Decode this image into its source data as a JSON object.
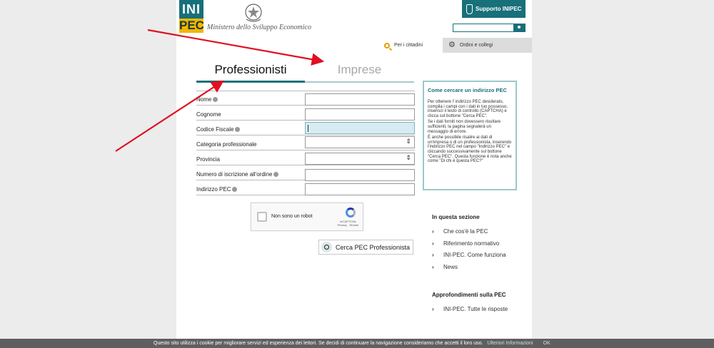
{
  "header": {
    "logo_top": "INI",
    "logo_bottom": "PEC",
    "ministry": "Ministero dello Sviluppo Economico",
    "support_label": "Supporto INIPEC",
    "search_placeholder": ""
  },
  "nav": {
    "cittadini": "Per i cittadini",
    "ordini": "Ordini e collegi"
  },
  "tabs": [
    {
      "label": "Professionisti",
      "active": true
    },
    {
      "label": "Imprese",
      "active": false
    }
  ],
  "form": {
    "fields": [
      {
        "label": "Nome",
        "info": true,
        "type": "text",
        "value": ""
      },
      {
        "label": "Cognome",
        "info": false,
        "type": "text",
        "value": ""
      },
      {
        "label": "Codice Fiscale",
        "info": true,
        "type": "text",
        "value": ""
      },
      {
        "label": "Categoria professionale",
        "info": false,
        "type": "select",
        "value": ""
      },
      {
        "label": "Provincia",
        "info": false,
        "type": "select",
        "value": ""
      },
      {
        "label": "Numero di iscrizione all'ordine",
        "info": true,
        "type": "text",
        "value": ""
      },
      {
        "label": "Indirizzo PEC",
        "info": true,
        "type": "text",
        "value": ""
      }
    ],
    "captcha_text": "Non sono un robot",
    "captcha_brand": "reCAPTCHA",
    "captcha_links": "Privacy - Termini",
    "submit_label": "Cerca PEC Professionista"
  },
  "help": {
    "title": "Come cercare un indirizzo PEC",
    "paragraphs": [
      "Per ottenere l' indirizzo PEC desiderato, compila i campi con i dati in tuo possesso, inserisci il testo di controllo (CAPTCHA) e clicca sul bottone \"Cerca PEC\".",
      "Se i dati forniti non dovessero risultare sufficienti, la pagina segnalerà un messaggio di errore.",
      "È anche possibile risalire ai dati di un'impresa o di un professionista, inserendo l'indirizzo PEC nel campo \"Indirizzo PEC\" e cliccando successivamente sul bottone \"Cerca PEC\". Questa funzione è nota anche come \"Di chi è questa PEC?\""
    ]
  },
  "section": {
    "heading": "In questa sezione",
    "items": [
      "Che cos'è la PEC",
      "Riferimento normativo",
      "INI-PEC. Come funziona",
      "News"
    ],
    "heading2": "Approfondimenti sulla PEC",
    "items2": [
      "INI-PEC. Tutte le risposte"
    ]
  },
  "cookie": {
    "text": "Questo sito utilizza i cookie per migliorare servizi ed esperienza dei lettori. Se decidi di continuare la navigazione consideriamo che accetti il loro uso.",
    "more": "Ulteriori Informazioni",
    "ok": "OK"
  },
  "colors": {
    "brand": "#17707a",
    "logo_yellow": "#f2b600",
    "annotation_red": "#e01020"
  }
}
